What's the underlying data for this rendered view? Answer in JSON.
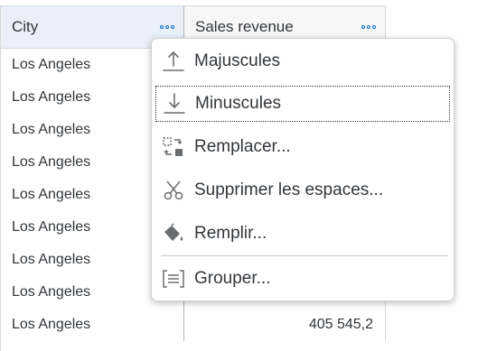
{
  "grid": {
    "columns": [
      {
        "label": "City"
      },
      {
        "label": "Sales revenue"
      }
    ],
    "rows": [
      {
        "city": "Los Angeles",
        "sales": ""
      },
      {
        "city": "Los Angeles",
        "sales": ""
      },
      {
        "city": "Los Angeles",
        "sales": ""
      },
      {
        "city": "Los Angeles",
        "sales": ""
      },
      {
        "city": "Los Angeles",
        "sales": ""
      },
      {
        "city": "Los Angeles",
        "sales": ""
      },
      {
        "city": "Los Angeles",
        "sales": ""
      },
      {
        "city": "Los Angeles",
        "sales": ""
      },
      {
        "city": "Los Angeles",
        "sales": "405 545,2"
      }
    ]
  },
  "menu": {
    "items": [
      {
        "label": "Majuscules",
        "icon": "uppercase-icon"
      },
      {
        "label": "Minuscules",
        "icon": "lowercase-icon"
      },
      {
        "label": "Remplacer...",
        "icon": "replace-icon"
      },
      {
        "label": "Supprimer les espaces...",
        "icon": "scissors-icon"
      },
      {
        "label": "Remplir...",
        "icon": "paint-bucket-icon"
      },
      {
        "label": "Grouper...",
        "icon": "group-icon"
      }
    ]
  },
  "colors": {
    "accent": "#0a6ed1",
    "text": "#32363a",
    "icon": "#6a6d70",
    "selected_header": "#eaf0fa"
  }
}
